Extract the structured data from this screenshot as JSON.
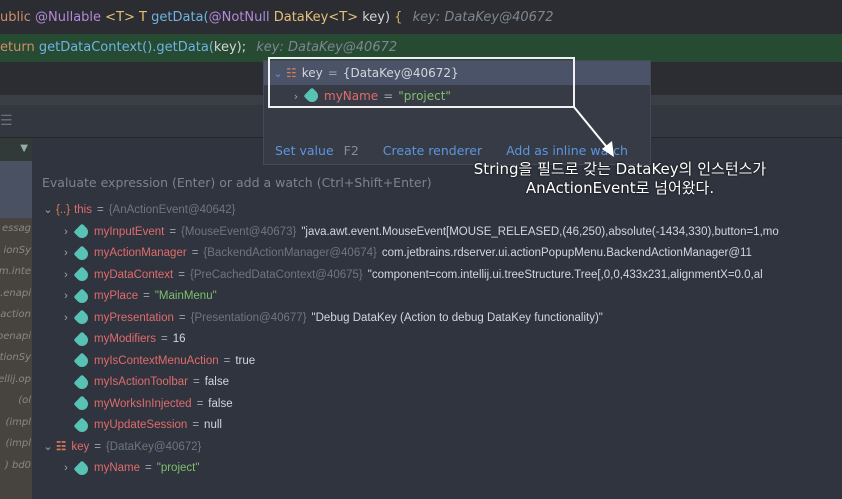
{
  "editor": {
    "line1": {
      "kw": "ublic",
      "ann1": "@Nullable",
      "tparam": "<T>",
      "ret": "T",
      "fn": "getData(",
      "ann2": "@NotNull",
      "type": "DataKey<T>",
      "param": "key)",
      "brace": "{",
      "hint": "key: DataKey@40672"
    },
    "line2": {
      "kw": "eturn",
      "call": "getDataContext().getData(",
      "arg": "key);",
      "hint": "key: DataKey@40672"
    }
  },
  "popup": {
    "root": {
      "name": "key",
      "eq": "=",
      "value": "{DataKey@40672}"
    },
    "child": {
      "name": "myName",
      "eq": "=",
      "value": "\"project\""
    },
    "actions": {
      "set_value": "Set value",
      "set_value_shortcut": "F2",
      "create_renderer": "Create renderer",
      "add_inline_watch": "Add as inline watch"
    }
  },
  "annotation": {
    "line1": "String을 필드로 갖는 DataKey의 인스턴스가",
    "line2": "AnActionEvent로 넘어왔다."
  },
  "frames": [
    "essag",
    "ionSy",
    "m.inte",
    "enapi.",
    "action",
    "penapi",
    "tionSy",
    "ellij.op",
    "ol)",
    "impl)",
    "impl)",
    "bd0 ("
  ],
  "evaluate": {
    "placeholder": "Evaluate expression (Enter) or add a watch (Ctrl+Shift+Enter)"
  },
  "variables": {
    "this": {
      "name": "this",
      "ref": "{AnActionEvent@40642}"
    },
    "fields": [
      {
        "name": "myInputEvent",
        "ref": "{MouseEvent@40673}",
        "value": "\"java.awt.event.MouseEvent[MOUSE_RELEASED,(46,250),absolute(-1434,330),button=1,mo"
      },
      {
        "name": "myActionManager",
        "ref": "{BackendActionManager@40674}",
        "value": "com.jetbrains.rdserver.ui.actionPopupMenu.BackendActionManager@11"
      },
      {
        "name": "myDataContext",
        "ref": "{PreCachedDataContext@40675}",
        "value": "\"component=com.intellij.ui.treeStructure.Tree[,0,0,433x231,alignmentX=0.0,al"
      },
      {
        "name": "myPlace",
        "ref": "",
        "value": "\"MainMenu\""
      },
      {
        "name": "myPresentation",
        "ref": "{Presentation@40677}",
        "value": "\"Debug DataKey (Action to debug DataKey functionality)\""
      },
      {
        "name": "myModifiers",
        "ref": "",
        "value": "16"
      },
      {
        "name": "myIsContextMenuAction",
        "ref": "",
        "value": "true"
      },
      {
        "name": "myIsActionToolbar",
        "ref": "",
        "value": "false"
      },
      {
        "name": "myWorksInInjected",
        "ref": "",
        "value": "false"
      },
      {
        "name": "myUpdateSession",
        "ref": "",
        "value": "null"
      }
    ],
    "key": {
      "name": "key",
      "ref": "{DataKey@40672}"
    },
    "key_child": {
      "name": "myName",
      "value": "\"project\""
    }
  }
}
